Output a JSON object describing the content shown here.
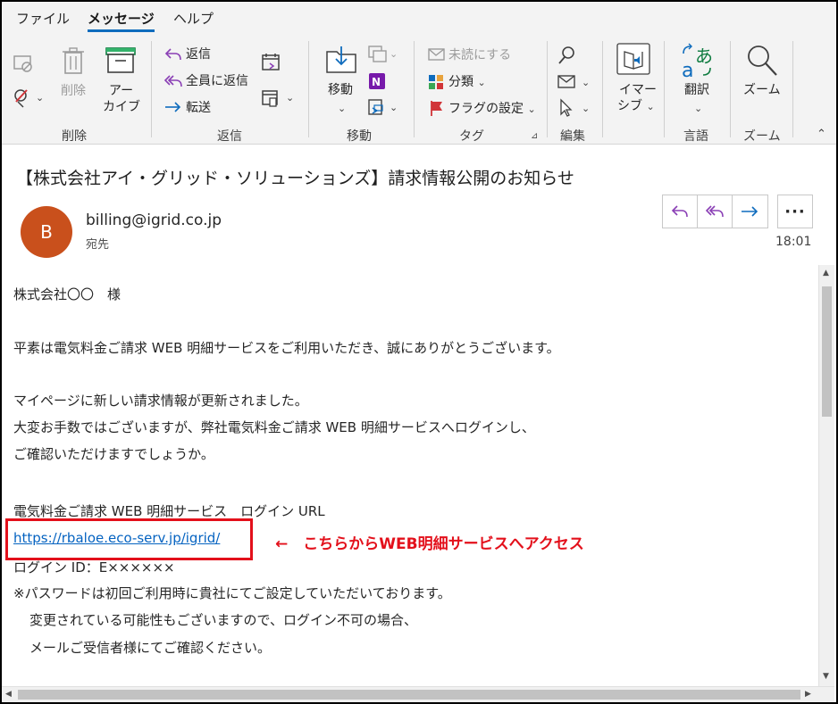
{
  "tabs": [
    "ファイル",
    "メッセージ",
    "ヘルプ"
  ],
  "ribbon": {
    "delete_group": {
      "delete": "削除",
      "archive_1": "アー",
      "archive_2": "カイブ",
      "name": "削除"
    },
    "respond_group": {
      "reply": "返信",
      "reply_all": "全員に返信",
      "forward": "転送",
      "name": "返信"
    },
    "move_group": {
      "move": "移動",
      "name": "移動"
    },
    "tags_group": {
      "unread": "未読にする",
      "categorize": "分類",
      "flag": "フラグの設定",
      "name": "タグ"
    },
    "edit_group": {
      "name": "編集"
    },
    "immersive_group": {
      "immersive_1": "イマー",
      "immersive_2": "シブ"
    },
    "language_group": {
      "translate": "翻訳",
      "name": "言語"
    },
    "zoom_group": {
      "zoom": "ズーム",
      "name": "ズーム"
    }
  },
  "email": {
    "subject": "【株式会社アイ・グリッド・ソリューションズ】請求情報公開のお知らせ",
    "avatar_initial": "B",
    "sender": "billing@igrid.co.jp",
    "recipient_label": "宛先",
    "time": "18:01",
    "body": {
      "greeting": "株式会社〇〇　様",
      "intro": "平素は電気料金ご請求 WEB 明細サービスをご利用いただき、誠にありがとうございます。",
      "para1": "マイページに新しい請求情報が更新されました。",
      "para2": "大変お手数ではございますが、弊社電気料金ご請求 WEB 明細サービスへログインし、",
      "para3": "ご確認いただけますでしょうか。",
      "url_label": "電気料金ご請求 WEB 明細サービス　ログイン URL",
      "url": "https://rbaloe.eco-serv.jp/igrid/",
      "login_id": "ログイン ID：E××××××",
      "note1": "※パスワードは初回ご利用時に貴社にてご設定していただいております。",
      "note2": "変更されている可能性もございますので、ログイン不可の場合、",
      "note3": "メールご受信者様にてご確認ください。"
    }
  },
  "annotation": {
    "text": "←　こちらからWEB明細サービスへアクセス"
  },
  "colors": {
    "accent": "#0f6cbd",
    "avatar": "#c9501c",
    "link": "#0563c1",
    "annotation": "#e3101b"
  }
}
